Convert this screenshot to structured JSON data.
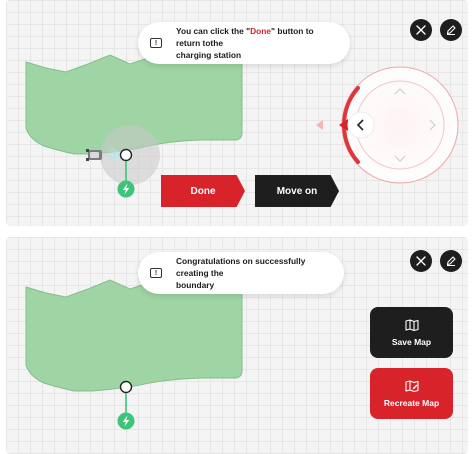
{
  "screen1": {
    "toast": {
      "prefix": "You can click the \"",
      "highlight": "Done",
      "suffix": "\" button to return tothe",
      "line2": "charging station"
    },
    "close_icon": "close-icon",
    "edit_icon": "pencil-icon",
    "done_label": "Done",
    "move_on_label": "Move on",
    "joystick_icon": "chevron-left-icon"
  },
  "screen2": {
    "toast": {
      "line1": "Congratulations on successfully creating the",
      "line2": "boundary"
    },
    "close_icon": "close-icon",
    "edit_icon": "pencil-icon",
    "save_map_label": "Save Map",
    "recreate_map_label": "Recreate Map",
    "save_map_icon": "map-icon",
    "recreate_map_icon": "map-edit-icon"
  },
  "colors": {
    "accent_red": "#d8232a",
    "dark": "#1e1e1e",
    "map_green": "#9fd4a4",
    "charger_green": "#3dc47a",
    "grid_bg": "#f4f4f4"
  }
}
